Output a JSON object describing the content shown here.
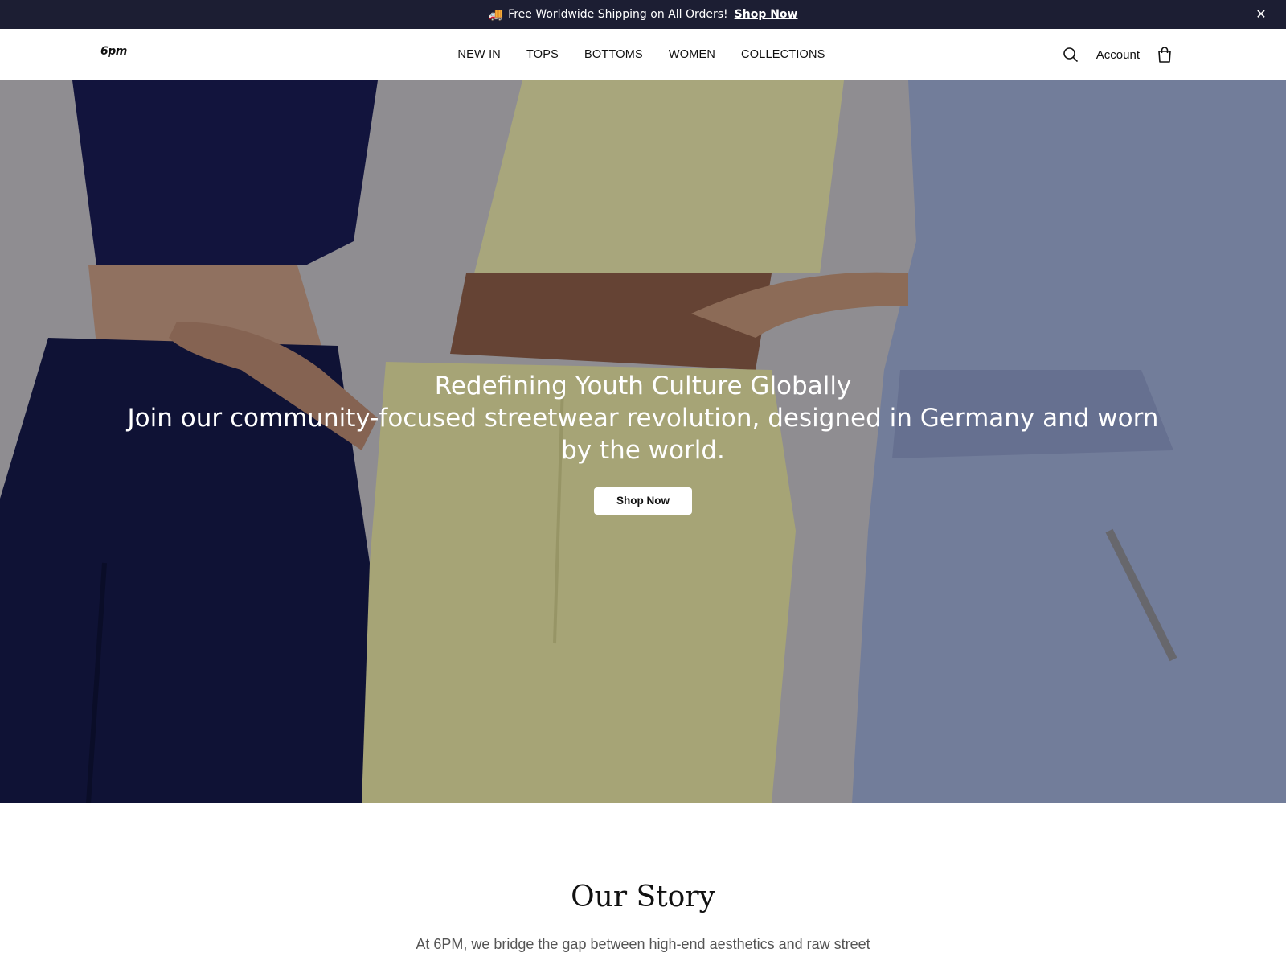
{
  "announcement": {
    "icon": "truck-icon",
    "message": "Free Worldwide Shipping on All Orders!",
    "link": "Shop Now"
  },
  "header": {
    "logo": "6pm",
    "nav": [
      "NEW IN",
      "TOPS",
      "BOTTOMS",
      "WOMEN",
      "COLLECTIONS"
    ],
    "account": "Account"
  },
  "hero": {
    "title": "Redefining Youth Culture Globally",
    "subtitle": "Join our community-focused streetwear revolution, designed in Germany and worn by the world.",
    "cta": "Shop Now",
    "colors": {
      "navy": "#161a4a",
      "butter": "#e6e3a4",
      "periwinkle": "#9fadd6"
    }
  },
  "story": {
    "heading": "Our Story",
    "text": "At 6PM, we bridge the gap between high-end aesthetics and raw street"
  }
}
